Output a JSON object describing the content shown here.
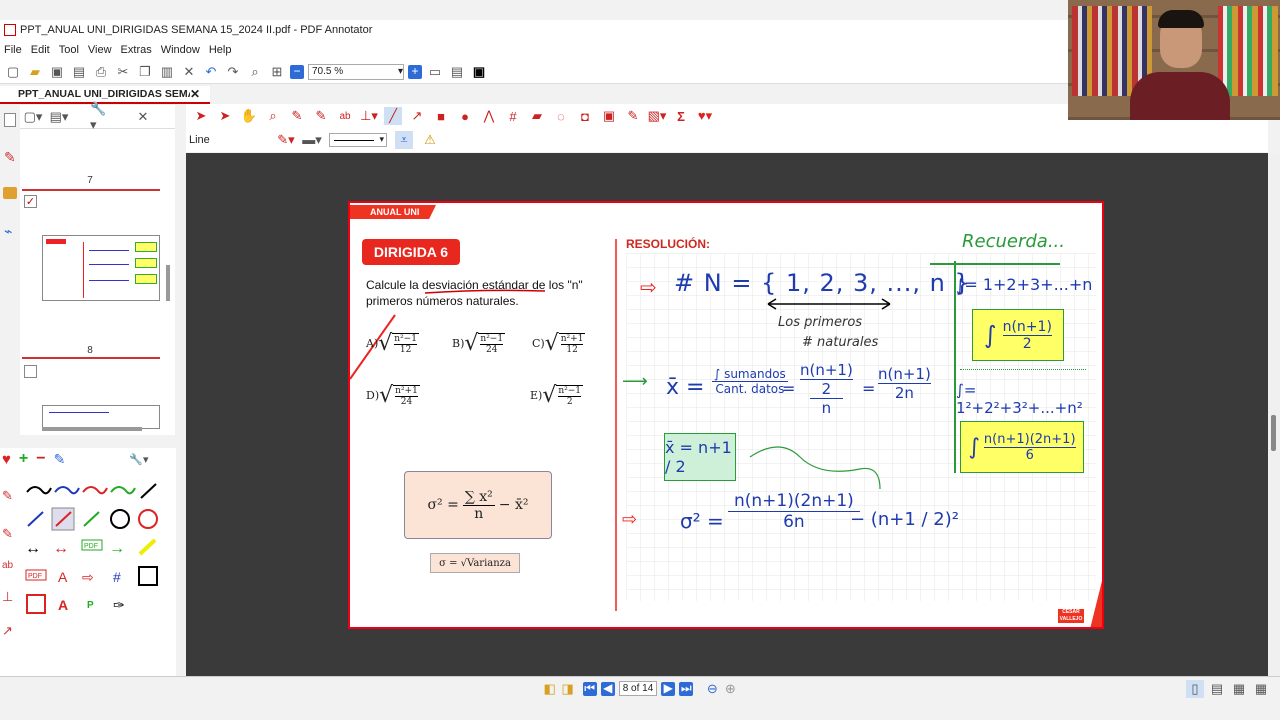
{
  "window": {
    "title": "PPT_ANUAL UNI_DIRIGIDAS SEMANA 15_2024 II.pdf - PDF Annotator"
  },
  "menu": [
    "File",
    "Edit",
    "Tool",
    "View",
    "Extras",
    "Window",
    "Help"
  ],
  "toolbar": {
    "zoom": "70.5 %"
  },
  "doc_tab": {
    "label": "PPT_ANUAL UNI_DIRIGIDAS SEMA...",
    "close": "✕"
  },
  "tool_sub": {
    "label": "Line"
  },
  "thumbnails": {
    "page7": "7",
    "page8": "8"
  },
  "status": {
    "page_indicator": "8 of 14"
  },
  "slide": {
    "banner": "ANUAL UNI",
    "dirigida": "DIRIGIDA 6",
    "question_line1": "Calcule la desviación estándar de los \"n\"",
    "question_line2": "primeros números naturales.",
    "options": {
      "a": {
        "letter": "A)",
        "num": "n²−1",
        "den": "12"
      },
      "b": {
        "letter": "B)",
        "num": "n²−1",
        "den": "24"
      },
      "c": {
        "letter": "C)",
        "num": "n²+1",
        "den": "12"
      },
      "d": {
        "letter": "D)",
        "num": "n²+1",
        "den": "24"
      },
      "e": {
        "letter": "E)",
        "num": "n²−1",
        "den": "2"
      }
    },
    "formula_lhs": "σ² =",
    "formula_num": "∑ x²",
    "formula_den": "n",
    "formula_rhs": "− x̄²",
    "sigma_note": "σ = √Varianza",
    "resolucion": "RESOLUCIÓN:",
    "brand": "CÉSAR VALLEJO"
  },
  "handwriting": {
    "recuerda": "Recuerda...",
    "sum_n": "∫= 1+2+3+...+n",
    "sum_n_result_num": "n(n+1)",
    "sum_n_result_den": "2",
    "sum_sq": "∫= 1²+2²+3²+...+n²",
    "sum_sq_result_num": "n(n+1)(2n+1)",
    "sum_sq_result_den": "6",
    "setN": "# N = { 1, 2, 3, ..., n }",
    "los_primeros": "Los primeros",
    "naturales": "# naturales",
    "mean_lhs": "x̄ =",
    "mean_frac1_num": "∫ sumandos",
    "mean_frac1_den": "Cant. datos",
    "mean_frac2_num": "n(n+1)",
    "mean_frac2_mid": "2",
    "mean_frac2_den": "n",
    "mean_frac3_num": "n(n+1)",
    "mean_frac3_den": "2n",
    "mean_box": "x̄ = n+1 / 2",
    "var_lhs": "σ² =",
    "var_num": "n(n+1)(2n+1)",
    "var_den": "6n",
    "var_tail": "− (n+1 / 2)²"
  }
}
